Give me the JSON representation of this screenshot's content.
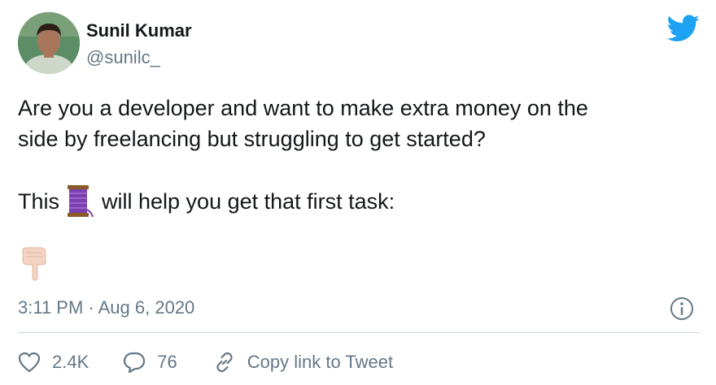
{
  "author": {
    "name": "Sunil Kumar",
    "handle": "@sunilc_",
    "avatar_icon": "profile-photo"
  },
  "tweet": {
    "line1": "Are you a developer and want to make extra money on the",
    "line2": "side by freelancing but struggling to get started?",
    "line3_before": "This",
    "line3_emoji": "thread-spool-emoji",
    "line3_after": "will help you get that first task:",
    "line4_emoji": "backhand-index-pointing-down-emoji"
  },
  "timestamp": "3:11 PM · Aug 6, 2020",
  "actions": {
    "likes": "2.4K",
    "replies": "76",
    "copy_link": "Copy link to Tweet"
  },
  "icons": {
    "brand": "twitter-bird-icon",
    "info": "info-icon",
    "like": "heart-icon",
    "reply": "speech-bubble-icon",
    "link": "link-icon"
  },
  "colors": {
    "text": "#14171a",
    "secondary": "#657786",
    "twitter_blue": "#1da1f2",
    "divider": "#ccd6dd"
  }
}
